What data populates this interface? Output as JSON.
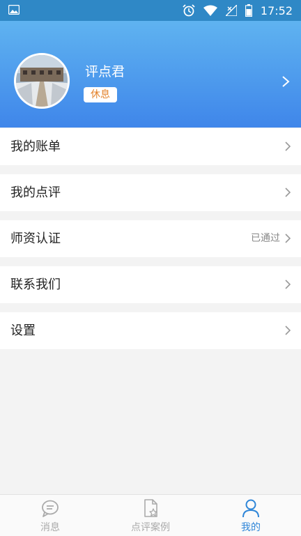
{
  "status_bar": {
    "time": "17:52"
  },
  "profile": {
    "name": "评点君",
    "status_badge": "休息"
  },
  "menu": {
    "items": [
      {
        "label": "我的账单",
        "status": ""
      },
      {
        "label": "我的点评",
        "status": ""
      },
      {
        "label": "师资认证",
        "status": "已通过"
      },
      {
        "label": "联系我们",
        "status": ""
      },
      {
        "label": "设置",
        "status": ""
      }
    ]
  },
  "tabbar": {
    "tabs": [
      {
        "label": "消息",
        "icon": "chat-bubble-icon",
        "active": false
      },
      {
        "label": "点评案例",
        "icon": "document-star-icon",
        "active": false
      },
      {
        "label": "我的",
        "icon": "person-icon",
        "active": true
      }
    ]
  },
  "colors": {
    "status_bar": "#2f88c6",
    "header_top": "#5fb3f0",
    "header_bottom": "#3f86ea",
    "badge_text": "#e3822a",
    "active_tab": "#2f86d8",
    "inactive_tab": "#aaaaaa"
  }
}
